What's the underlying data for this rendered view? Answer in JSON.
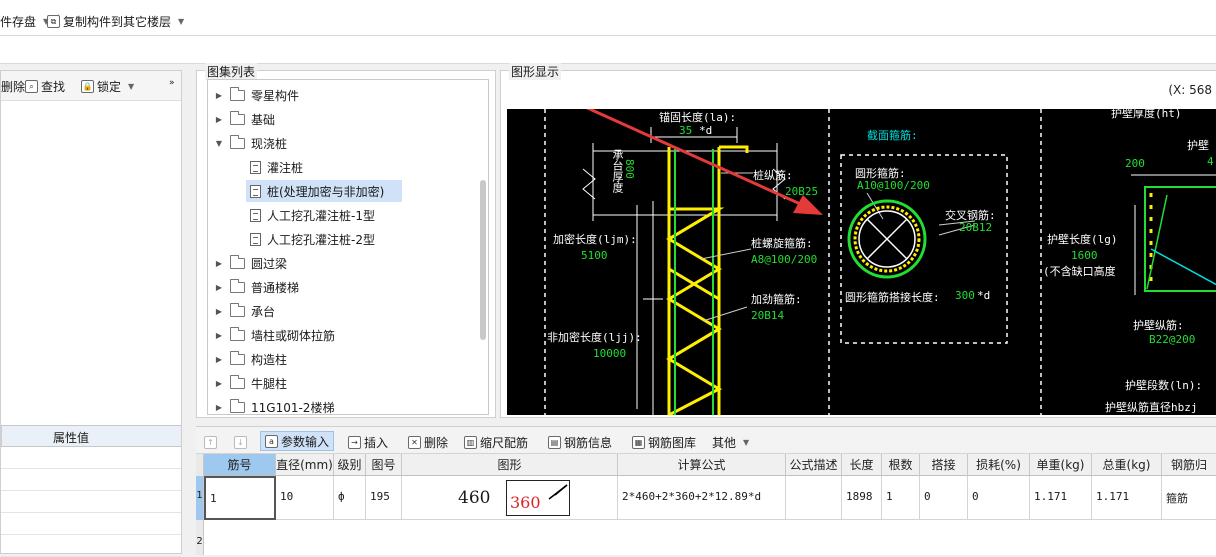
{
  "top_toolbar": {
    "save_label": "件存盘",
    "copy_label": "复制构件到其它楼层"
  },
  "left_panel": {
    "toolbar": {
      "delete_label": "删除",
      "find_label": "查找",
      "lock_label": "锁定"
    },
    "prop_header": "属性值"
  },
  "tree_panel": {
    "title": "图集列表",
    "items": [
      {
        "label": "零星构件"
      },
      {
        "label": "基础"
      },
      {
        "label": "现浇桩"
      },
      {
        "label": "灌注桩"
      },
      {
        "label": "桩(处理加密与非加密)"
      },
      {
        "label": "人工挖孔灌注桩-1型"
      },
      {
        "label": "人工挖孔灌注桩-2型"
      },
      {
        "label": "圆过梁"
      },
      {
        "label": "普通楼梯"
      },
      {
        "label": "承台"
      },
      {
        "label": "墙柱或砌体拉筋"
      },
      {
        "label": "构造柱"
      },
      {
        "label": "牛腿柱"
      },
      {
        "label": "11G101-2楼梯"
      }
    ]
  },
  "graphic_panel": {
    "title": "图形显示",
    "coord": "(X: 568",
    "cad": {
      "anchor_len": "锚固长度(la):",
      "anchor_val": "35",
      "anchor_unit": "*d",
      "cap_thk": "承台厚度",
      "cap_val": "800",
      "long_bar": "桩纵筋:",
      "long_val": "20B25",
      "dense_len": "加密长度(ljm):",
      "dense_val": "5100",
      "spiral": "桩螺旋箍筋:",
      "spiral_val": "A8@100/200",
      "stiff": "加劲箍筋:",
      "stiff_val": "20B14",
      "nondense": "非加密长度(ljj):",
      "nondense_val": "10000",
      "section": "截面箍筋:",
      "circ": "圆形箍筋:",
      "circ_val": "A10@100/200",
      "cross": "交叉钢筋:",
      "cross_val": "20B12",
      "lap": "圆形箍筋搭接长度:",
      "lap_val": "300",
      "lap_unit": "*d",
      "wall_thk": "护壁厚度(ht)",
      "wall_thk_val": "200",
      "wall_p": "护壁",
      "wall_p_val": "4",
      "wall_len": "护壁长度(lg)",
      "wall_len_val": "1600",
      "wall_note": "(不含缺口高度",
      "wall_long": "护壁纵筋:",
      "wall_long_val": "B22@200",
      "wall_segs": "护壁段数(ln):",
      "wall_dia": "护壁纵筋直径hbzj"
    }
  },
  "bottom_toolbar": {
    "param_input": "参数输入",
    "insert": "插入",
    "delete": "删除",
    "scale": "缩尺配筋",
    "rebar_info": "钢筋信息",
    "rebar_lib": "钢筋图库",
    "other": "其他"
  },
  "grid": {
    "columns": [
      "筋号",
      "直径(mm)",
      "级别",
      "图号",
      "图形",
      "计算公式",
      "公式描述",
      "长度",
      "根数",
      "搭接",
      "损耗(%)",
      "单重(kg)",
      "总重(kg)",
      "钢筋归"
    ],
    "rows": [
      {
        "row_no": "1",
        "cells": [
          "1",
          "10",
          "ф",
          "195",
          "",
          "2*460+2*360+2*12.89*d",
          "",
          "1898",
          "1",
          "0",
          "0",
          "1.171",
          "1.171",
          "箍筋"
        ],
        "shape_a": "460",
        "shape_b": "360"
      },
      {
        "row_no": "2"
      }
    ]
  },
  "colors": {
    "cad_bg": "#000000",
    "cad_green": "#22dd33",
    "cad_yellow": "#ffee00",
    "arrow_red": "#e53a3a",
    "selection": "#cfe2f7"
  }
}
